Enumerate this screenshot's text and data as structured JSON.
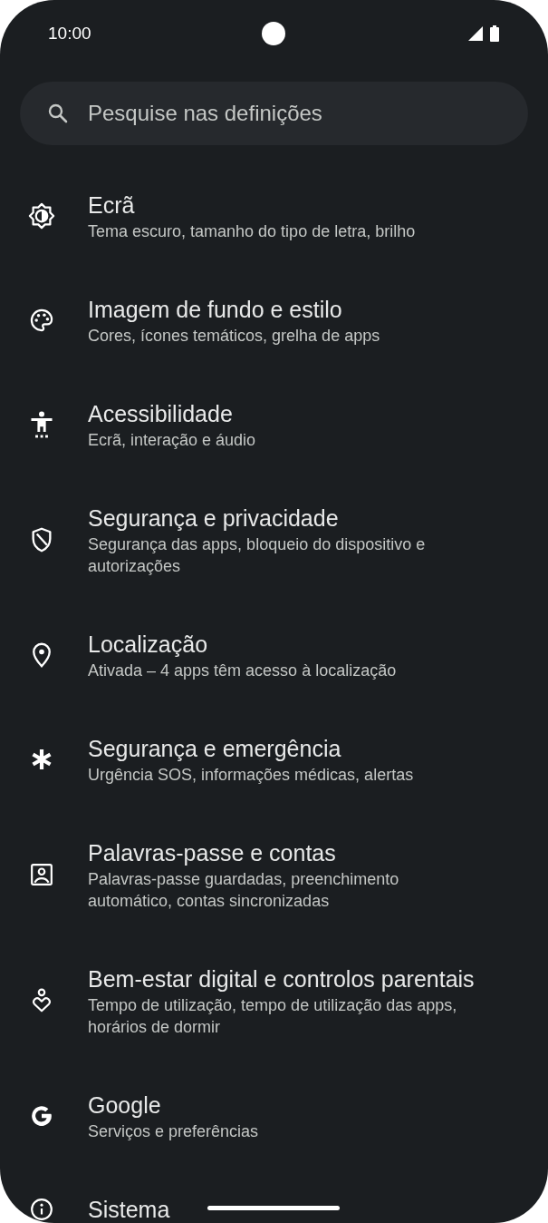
{
  "status_bar": {
    "time": "10:00"
  },
  "search": {
    "placeholder": "Pesquise nas definições"
  },
  "items": [
    {
      "kind": "display",
      "title": "Ecrã",
      "subtitle": "Tema escuro, tamanho do tipo de letra, brilho"
    },
    {
      "kind": "palette",
      "title": "Imagem de fundo e estilo",
      "subtitle": "Cores, ícones temáticos, grelha de apps"
    },
    {
      "kind": "accessibility",
      "title": "Acessibilidade",
      "subtitle": "Ecrã, interação e áudio"
    },
    {
      "kind": "shield",
      "title": "Segurança e privacidade",
      "subtitle": "Segurança das apps, bloqueio do dispositivo e autorizações"
    },
    {
      "kind": "location",
      "title": "Localização",
      "subtitle": "Ativada – 4 apps têm acesso à localização"
    },
    {
      "kind": "asterisk",
      "title": "Segurança e emergência",
      "subtitle": "Urgência SOS, informações médicas, alertas"
    },
    {
      "kind": "account",
      "title": "Palavras-passe e contas",
      "subtitle": "Palavras-passe guardadas, preenchimento automático, contas sincronizadas"
    },
    {
      "kind": "wellbeing",
      "title": "Bem-estar digital e controlos parentais",
      "subtitle": "Tempo de utilização, tempo de utilização das apps, horários de dormir"
    },
    {
      "kind": "google",
      "title": "Google",
      "subtitle": "Serviços e preferências"
    },
    {
      "kind": "info",
      "title": "Sistema"
    }
  ]
}
